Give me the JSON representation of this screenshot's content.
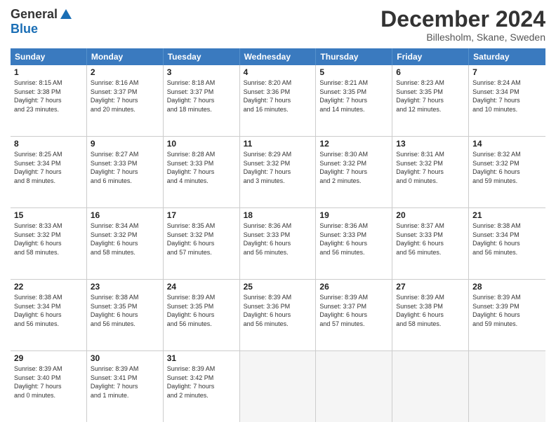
{
  "logo": {
    "general": "General",
    "blue": "Blue"
  },
  "title": "December 2024",
  "location": "Billesholm, Skane, Sweden",
  "days_of_week": [
    "Sunday",
    "Monday",
    "Tuesday",
    "Wednesday",
    "Thursday",
    "Friday",
    "Saturday"
  ],
  "weeks": [
    [
      {
        "day": "1",
        "lines": [
          "Sunrise: 8:15 AM",
          "Sunset: 3:38 PM",
          "Daylight: 7 hours",
          "and 23 minutes."
        ]
      },
      {
        "day": "2",
        "lines": [
          "Sunrise: 8:16 AM",
          "Sunset: 3:37 PM",
          "Daylight: 7 hours",
          "and 20 minutes."
        ]
      },
      {
        "day": "3",
        "lines": [
          "Sunrise: 8:18 AM",
          "Sunset: 3:37 PM",
          "Daylight: 7 hours",
          "and 18 minutes."
        ]
      },
      {
        "day": "4",
        "lines": [
          "Sunrise: 8:20 AM",
          "Sunset: 3:36 PM",
          "Daylight: 7 hours",
          "and 16 minutes."
        ]
      },
      {
        "day": "5",
        "lines": [
          "Sunrise: 8:21 AM",
          "Sunset: 3:35 PM",
          "Daylight: 7 hours",
          "and 14 minutes."
        ]
      },
      {
        "day": "6",
        "lines": [
          "Sunrise: 8:23 AM",
          "Sunset: 3:35 PM",
          "Daylight: 7 hours",
          "and 12 minutes."
        ]
      },
      {
        "day": "7",
        "lines": [
          "Sunrise: 8:24 AM",
          "Sunset: 3:34 PM",
          "Daylight: 7 hours",
          "and 10 minutes."
        ]
      }
    ],
    [
      {
        "day": "8",
        "lines": [
          "Sunrise: 8:25 AM",
          "Sunset: 3:34 PM",
          "Daylight: 7 hours",
          "and 8 minutes."
        ]
      },
      {
        "day": "9",
        "lines": [
          "Sunrise: 8:27 AM",
          "Sunset: 3:33 PM",
          "Daylight: 7 hours",
          "and 6 minutes."
        ]
      },
      {
        "day": "10",
        "lines": [
          "Sunrise: 8:28 AM",
          "Sunset: 3:33 PM",
          "Daylight: 7 hours",
          "and 4 minutes."
        ]
      },
      {
        "day": "11",
        "lines": [
          "Sunrise: 8:29 AM",
          "Sunset: 3:32 PM",
          "Daylight: 7 hours",
          "and 3 minutes."
        ]
      },
      {
        "day": "12",
        "lines": [
          "Sunrise: 8:30 AM",
          "Sunset: 3:32 PM",
          "Daylight: 7 hours",
          "and 2 minutes."
        ]
      },
      {
        "day": "13",
        "lines": [
          "Sunrise: 8:31 AM",
          "Sunset: 3:32 PM",
          "Daylight: 7 hours",
          "and 0 minutes."
        ]
      },
      {
        "day": "14",
        "lines": [
          "Sunrise: 8:32 AM",
          "Sunset: 3:32 PM",
          "Daylight: 6 hours",
          "and 59 minutes."
        ]
      }
    ],
    [
      {
        "day": "15",
        "lines": [
          "Sunrise: 8:33 AM",
          "Sunset: 3:32 PM",
          "Daylight: 6 hours",
          "and 58 minutes."
        ]
      },
      {
        "day": "16",
        "lines": [
          "Sunrise: 8:34 AM",
          "Sunset: 3:32 PM",
          "Daylight: 6 hours",
          "and 58 minutes."
        ]
      },
      {
        "day": "17",
        "lines": [
          "Sunrise: 8:35 AM",
          "Sunset: 3:32 PM",
          "Daylight: 6 hours",
          "and 57 minutes."
        ]
      },
      {
        "day": "18",
        "lines": [
          "Sunrise: 8:36 AM",
          "Sunset: 3:33 PM",
          "Daylight: 6 hours",
          "and 56 minutes."
        ]
      },
      {
        "day": "19",
        "lines": [
          "Sunrise: 8:36 AM",
          "Sunset: 3:33 PM",
          "Daylight: 6 hours",
          "and 56 minutes."
        ]
      },
      {
        "day": "20",
        "lines": [
          "Sunrise: 8:37 AM",
          "Sunset: 3:33 PM",
          "Daylight: 6 hours",
          "and 56 minutes."
        ]
      },
      {
        "day": "21",
        "lines": [
          "Sunrise: 8:38 AM",
          "Sunset: 3:34 PM",
          "Daylight: 6 hours",
          "and 56 minutes."
        ]
      }
    ],
    [
      {
        "day": "22",
        "lines": [
          "Sunrise: 8:38 AM",
          "Sunset: 3:34 PM",
          "Daylight: 6 hours",
          "and 56 minutes."
        ]
      },
      {
        "day": "23",
        "lines": [
          "Sunrise: 8:38 AM",
          "Sunset: 3:35 PM",
          "Daylight: 6 hours",
          "and 56 minutes."
        ]
      },
      {
        "day": "24",
        "lines": [
          "Sunrise: 8:39 AM",
          "Sunset: 3:35 PM",
          "Daylight: 6 hours",
          "and 56 minutes."
        ]
      },
      {
        "day": "25",
        "lines": [
          "Sunrise: 8:39 AM",
          "Sunset: 3:36 PM",
          "Daylight: 6 hours",
          "and 56 minutes."
        ]
      },
      {
        "day": "26",
        "lines": [
          "Sunrise: 8:39 AM",
          "Sunset: 3:37 PM",
          "Daylight: 6 hours",
          "and 57 minutes."
        ]
      },
      {
        "day": "27",
        "lines": [
          "Sunrise: 8:39 AM",
          "Sunset: 3:38 PM",
          "Daylight: 6 hours",
          "and 58 minutes."
        ]
      },
      {
        "day": "28",
        "lines": [
          "Sunrise: 8:39 AM",
          "Sunset: 3:39 PM",
          "Daylight: 6 hours",
          "and 59 minutes."
        ]
      }
    ],
    [
      {
        "day": "29",
        "lines": [
          "Sunrise: 8:39 AM",
          "Sunset: 3:40 PM",
          "Daylight: 7 hours",
          "and 0 minutes."
        ]
      },
      {
        "day": "30",
        "lines": [
          "Sunrise: 8:39 AM",
          "Sunset: 3:41 PM",
          "Daylight: 7 hours",
          "and 1 minute."
        ]
      },
      {
        "day": "31",
        "lines": [
          "Sunrise: 8:39 AM",
          "Sunset: 3:42 PM",
          "Daylight: 7 hours",
          "and 2 minutes."
        ]
      },
      {
        "day": "",
        "lines": []
      },
      {
        "day": "",
        "lines": []
      },
      {
        "day": "",
        "lines": []
      },
      {
        "day": "",
        "lines": []
      }
    ]
  ]
}
